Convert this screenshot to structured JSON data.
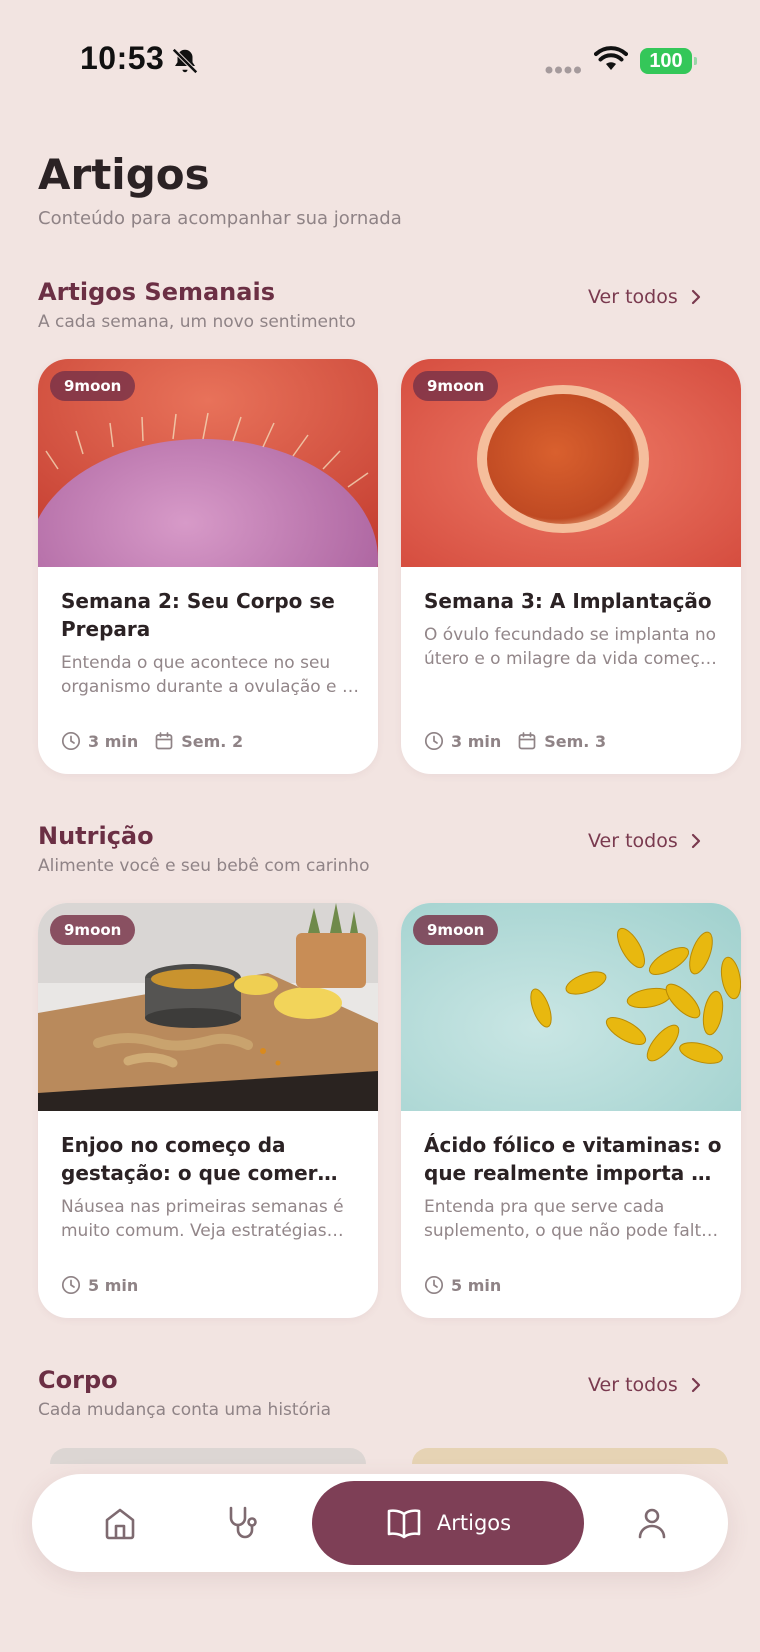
{
  "status_bar": {
    "time": "10:53",
    "battery": "100"
  },
  "header": {
    "title": "Artigos",
    "subtitle": "Conteúdo para acompanhar sua jornada"
  },
  "sections": [
    {
      "title": "Artigos Semanais",
      "subtitle": "A cada semana, um novo sentimento",
      "see_all": "Ver todos",
      "cards": [
        {
          "badge": "9moon",
          "title": "Semana 2: Seu Corpo se Prepara",
          "description": "Entenda o que acontece no seu organismo durante a ovulação e o que esperar nesta fase",
          "read_time": "3 min",
          "week": "Sem. 2",
          "image": "pink-cell-photo"
        },
        {
          "badge": "9moon",
          "title": "Semana 3: A Implantação",
          "description": "O óvulo fecundado se implanta no útero e o milagre da vida começa a acontecer",
          "read_time": "3 min",
          "week": "Sem. 3",
          "image": "orange-ovum-photo"
        }
      ]
    },
    {
      "title": "Nutrição",
      "subtitle": "Alimente você e seu bebê com carinho",
      "see_all": "Ver todos",
      "cards": [
        {
          "badge": "9moon",
          "title": "Enjoo no começo da gestação: o que comer quando nada para no estômago",
          "description": "Náusea nas primeiras semanas é muito comum. Veja estratégias simples para aliviar",
          "read_time": "5 min",
          "image": "ginger-tea-photo"
        },
        {
          "badge": "9moon",
          "title": "Ácido fólico e vitaminas: o que realmente importa no pré-natal",
          "description": "Entenda pra que serve cada suplemento, o que não pode faltar na sua rotina",
          "read_time": "5 min",
          "image": "vitamin-capsules-photo"
        }
      ]
    },
    {
      "title": "Corpo",
      "subtitle": "Cada mudança conta uma história",
      "see_all": "Ver todos"
    }
  ],
  "bottom_nav": {
    "items": [
      {
        "icon": "home-icon"
      },
      {
        "icon": "stethoscope-icon"
      },
      {
        "icon": "book-open-icon",
        "label": "Artigos",
        "active": true
      },
      {
        "icon": "user-icon"
      }
    ]
  },
  "colors": {
    "background": "#F2E4E1",
    "accent": "#7E3F56",
    "section_title": "#6B2F44",
    "card": "#FFFFFF",
    "battery": "#34C759"
  }
}
